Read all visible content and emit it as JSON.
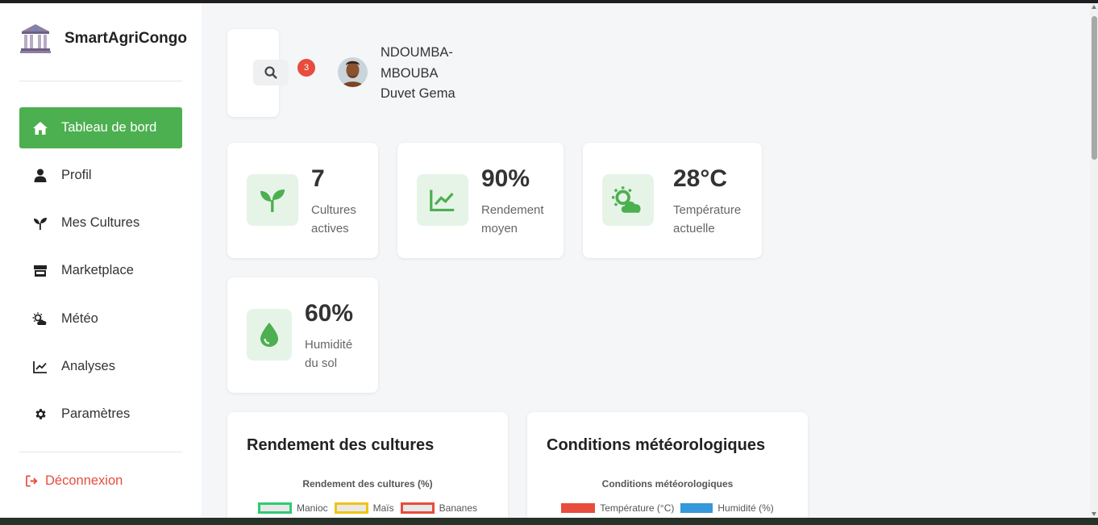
{
  "brand": {
    "name": "SmartAgriCongo"
  },
  "sidebar": {
    "items": [
      {
        "label": "Tableau de bord",
        "icon": "home-icon",
        "active": true
      },
      {
        "label": "Profil",
        "icon": "user-icon"
      },
      {
        "label": "Mes Cultures",
        "icon": "seedling-icon"
      },
      {
        "label": "Marketplace",
        "icon": "store-icon"
      },
      {
        "label": "Météo",
        "icon": "cloud-sun-icon"
      },
      {
        "label": "Analyses",
        "icon": "chart-line-icon"
      },
      {
        "label": "Paramètres",
        "icon": "gear-icon"
      }
    ],
    "logout": "Déconnexion"
  },
  "header": {
    "notification_count": "3",
    "user_name": "NDOUMBA-MBOUBA Duvet Gema"
  },
  "stats": [
    {
      "value": "7",
      "label": "Cultures actives",
      "icon": "seedling-icon"
    },
    {
      "value": "90%",
      "label": "Rendement moyen",
      "icon": "chart-line-icon"
    },
    {
      "value": "28°C",
      "label": "Température actuelle",
      "icon": "cloud-sun-icon"
    },
    {
      "value": "60%",
      "label": "Humidité du sol",
      "icon": "droplet-icon"
    }
  ],
  "charts": [
    {
      "card_title": "Rendement des cultures",
      "inner_title": "Rendement des cultures (%)",
      "legend": [
        {
          "name": "Manioc",
          "color": "#2ecc71"
        },
        {
          "name": "Maïs",
          "color": "#f1c40f"
        },
        {
          "name": "Bananes",
          "color": "#e74c3c"
        }
      ]
    },
    {
      "card_title": "Conditions météorologiques",
      "inner_title": "Conditions météorologiques",
      "legend": [
        {
          "name": "Température (°C)",
          "color": "#e74c3c"
        },
        {
          "name": "Humidité (%)",
          "color": "#3498db"
        }
      ]
    }
  ],
  "colors": {
    "accent": "#4caf50",
    "danger": "#e74c3c",
    "icon_green": "#4caf50"
  }
}
